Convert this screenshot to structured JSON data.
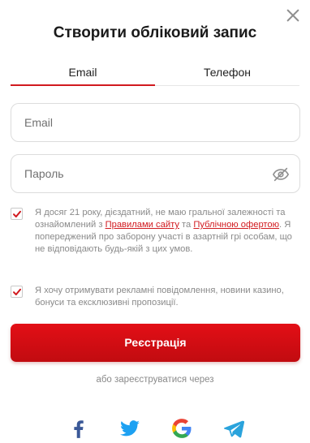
{
  "modal": {
    "title": "Створити обліковий запис"
  },
  "tabs": [
    {
      "label": "Email",
      "active": true
    },
    {
      "label": "Телефон",
      "active": false
    }
  ],
  "form": {
    "email_placeholder": "Email",
    "email_value": "",
    "password_placeholder": "Пароль",
    "password_value": ""
  },
  "consent": {
    "checked": true,
    "text_before": "Я досяг 21 року, дієздатний, не маю гральної залежності та ознайомлений з ",
    "rules_link": "Правилами сайту",
    "text_and": " та ",
    "offer_link": "Публічною офертою",
    "text_after": ". Я попереджений про заборону участі в азартній грі особам, що не відповідають будь-якій з цих умов."
  },
  "marketing": {
    "checked": true,
    "text": "Я хочу отримувати рекламні повідомлення, новини казино, бонуси та ексклюзивні пропозиції."
  },
  "submit_label": "Реєстрація",
  "alt_signup_text": "або зареєструватися через",
  "social_icons": [
    "facebook-icon",
    "twitter-icon",
    "google-icon",
    "telegram-icon"
  ],
  "colors": {
    "accent": "#d11a1f",
    "button": "#d9101a",
    "facebook": "#3b5998",
    "twitter": "#1da1f2",
    "telegram": "#2aa3dc"
  }
}
